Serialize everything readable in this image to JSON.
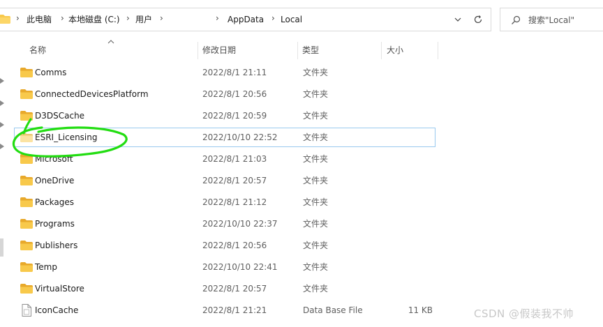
{
  "address_bar": {
    "crumbs": [
      "此电脑",
      "本地磁盘 (C:)",
      "用户",
      "AppData",
      "Local"
    ]
  },
  "search": {
    "placeholder": "搜索\"Local\"",
    "value": ""
  },
  "columns": {
    "name": "名称",
    "modified": "修改日期",
    "type": "类型",
    "size": "大小"
  },
  "files": [
    {
      "name": "Comms",
      "modified": "2022/8/1 21:11",
      "type": "文件夹",
      "size": "",
      "icon": "folder-icon"
    },
    {
      "name": "ConnectedDevicesPlatform",
      "modified": "2022/8/1 20:56",
      "type": "文件夹",
      "size": "",
      "icon": "folder-icon"
    },
    {
      "name": "D3DSCache",
      "modified": "2022/8/1 20:59",
      "type": "文件夹",
      "size": "",
      "icon": "folder-icon"
    },
    {
      "name": "ESRI_Licensing",
      "modified": "2022/10/10 22:52",
      "type": "文件夹",
      "size": "",
      "icon": "folder-icon",
      "selected": true
    },
    {
      "name": "Microsoft",
      "modified": "2022/8/1 21:03",
      "type": "文件夹",
      "size": "",
      "icon": "folder-icon"
    },
    {
      "name": "OneDrive",
      "modified": "2022/8/1 20:57",
      "type": "文件夹",
      "size": "",
      "icon": "folder-icon"
    },
    {
      "name": "Packages",
      "modified": "2022/8/1 21:12",
      "type": "文件夹",
      "size": "",
      "icon": "folder-icon"
    },
    {
      "name": "Programs",
      "modified": "2022/10/10 22:37",
      "type": "文件夹",
      "size": "",
      "icon": "folder-icon"
    },
    {
      "name": "Publishers",
      "modified": "2022/8/1 20:56",
      "type": "文件夹",
      "size": "",
      "icon": "folder-icon"
    },
    {
      "name": "Temp",
      "modified": "2022/10/10 22:41",
      "type": "文件夹",
      "size": "",
      "icon": "folder-icon"
    },
    {
      "name": "VirtualStore",
      "modified": "2022/8/1 20:57",
      "type": "文件夹",
      "size": "",
      "icon": "folder-icon"
    },
    {
      "name": "IconCache",
      "modified": "2022/8/1 21:21",
      "type": "Data Base File",
      "size": "11 KB",
      "icon": "file-icon"
    }
  ],
  "watermark": "CSDN @假装我不帅",
  "colors": {
    "folder_yellow": "#f8c94b",
    "selection_border": "#99c9ef",
    "annotation_green": "#22dd11"
  }
}
